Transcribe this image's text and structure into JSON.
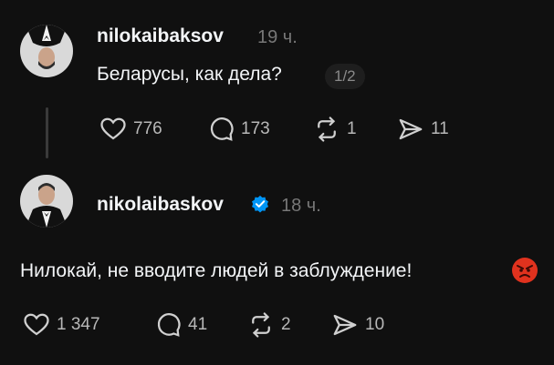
{
  "posts": [
    {
      "username": "nilokaibaksov",
      "time": "19 ч.",
      "text": "Беларусы, как дела?",
      "page_counter": "1/2",
      "verified": false,
      "actions": {
        "likes": "776",
        "replies": "173",
        "reposts": "1",
        "shares": "11"
      }
    },
    {
      "username": "nikolaibaskov",
      "time": "18 ч.",
      "text": "Нилокай, не вводите людей в заблуждение!",
      "verified": true,
      "emoji": "angry-face",
      "actions": {
        "likes": "1 347",
        "replies": "41",
        "reposts": "2",
        "shares": "10"
      }
    }
  ],
  "colors": {
    "background": "#101010",
    "text": "#f3f5f7",
    "muted": "#777777",
    "verified": "#0095f6"
  }
}
